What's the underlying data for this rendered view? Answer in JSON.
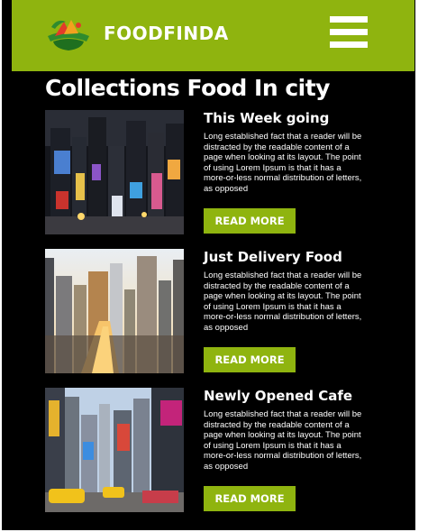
{
  "header": {
    "brand": "FOODFINDA",
    "logo_icon": "food-logo-icon",
    "menu_icon": "hamburger-menu-icon",
    "accent": "#8fb40f"
  },
  "page_title": "Collections Food In city",
  "cards": [
    {
      "title": "This Week going",
      "text": "Long established fact that a reader will be distracted by the readable content of a page when looking at its layout. The point of using Lorem Ipsum is that it has a more-or-less normal distribution of letters, as opposed",
      "button": "READ MORE"
    },
    {
      "title": "Just Delivery Food",
      "text": "Long established fact that a reader will be distracted by the readable content of a page when looking at its layout. The point of using Lorem Ipsum is that it has a more-or-less normal distribution of letters, as opposed",
      "button": "READ MORE"
    },
    {
      "title": "Newly Opened Cafe",
      "text": "Long established fact that a reader will be distracted by the readable content of a page when looking at its layout. The point of using Lorem Ipsum is that it has a more-or-less normal distribution of letters, as opposed",
      "button": "READ MORE"
    }
  ]
}
